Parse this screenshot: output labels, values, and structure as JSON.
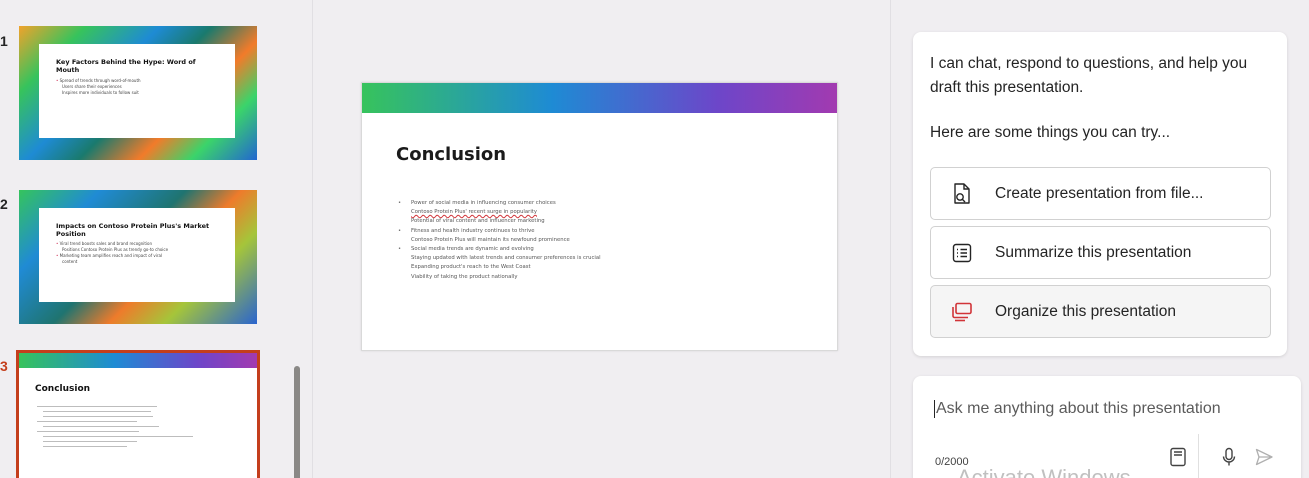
{
  "thumbnails": [
    {
      "number": "1",
      "title": "Key Factors Behind the Hype: Word of Mouth",
      "lines": [
        {
          "text": "Spread of trends through word-of-mouth",
          "kind": "bullet"
        },
        {
          "text": "Users share their experiences",
          "kind": "sub"
        },
        {
          "text": "Inspires more individuals to follow suit",
          "kind": "sub"
        }
      ]
    },
    {
      "number": "2",
      "title": "Impacts on Contoso Protein Plus's Market Position",
      "lines": [
        {
          "text": "Viral trend boosts sales and brand recognition",
          "kind": "bullet"
        },
        {
          "text": "Positions Contoso Protein Plus as trendy go-to choice",
          "kind": "sub"
        },
        {
          "text": "Marketing team amplifies reach and impact of viral",
          "kind": "bullet"
        },
        {
          "text": "content",
          "kind": "sub"
        }
      ]
    },
    {
      "number": "3",
      "title": "Conclusion",
      "active": true
    }
  ],
  "slide": {
    "title": "Conclusion",
    "lines": [
      {
        "text": "Power of social media in influencing consumer choices",
        "kind": "bullet"
      },
      {
        "text": "Contoso Protein Plus' recent surge in popularity",
        "kind": "sub",
        "spelling_flag": true
      },
      {
        "text": "Potential of viral content and influencer marketing",
        "kind": "sub"
      },
      {
        "text": "Fitness and health industry continues to thrive",
        "kind": "bullet"
      },
      {
        "text": "Contoso Protein Plus will maintain its newfound prominence",
        "kind": "sub"
      },
      {
        "text": "Social media trends are dynamic and evolving",
        "kind": "bullet"
      },
      {
        "text": "Staying updated with latest trends and consumer preferences is crucial",
        "kind": "sub"
      },
      {
        "text": "Expanding product's reach to the West Coast",
        "kind": "sub"
      },
      {
        "text": "Viability of taking the product nationally",
        "kind": "sub"
      }
    ]
  },
  "copilot": {
    "intro": "I can chat, respond to questions, and help you draft this presentation.",
    "try_text": "Here are some things you can try...",
    "suggestions": [
      {
        "label": "Create presentation from file...",
        "icon": "file-search-icon"
      },
      {
        "label": "Summarize this presentation",
        "icon": "list-icon"
      },
      {
        "label": "Organize this presentation",
        "icon": "slides-stack-icon"
      }
    ],
    "input": {
      "placeholder": "Ask me anything about this presentation",
      "counter": "0/2000"
    },
    "watermark": "Activate Windows"
  },
  "colors": {
    "accent": "#c43e1c",
    "organize_icon": "#d13438"
  }
}
